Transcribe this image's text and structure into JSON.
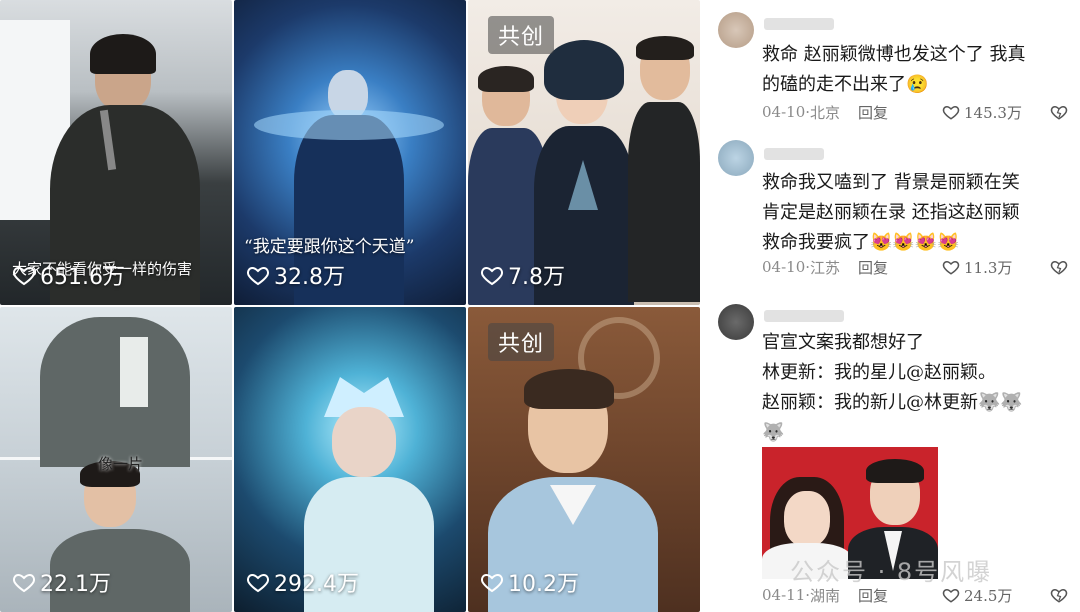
{
  "videos": [
    {
      "likes": "651.6万",
      "caption": "大家不能看你受一样的伤害",
      "badge": ""
    },
    {
      "likes": "32.8万",
      "caption": "“我定要跟你这个天道”",
      "badge": ""
    },
    {
      "likes": "7.8万",
      "caption": "",
      "badge": "共创"
    },
    {
      "likes": "22.1万",
      "caption": "像一片",
      "badge": ""
    },
    {
      "likes": "292.4万",
      "caption": "",
      "badge": ""
    },
    {
      "likes": "10.2万",
      "caption": "",
      "badge": "共创"
    }
  ],
  "comments": [
    {
      "text": "救命 赵丽颖微博也发这个了 我真\n的磕的走不出来了😢",
      "date": "04-10",
      "location": "北京",
      "reply": "回复",
      "likes": "145.3万"
    },
    {
      "text": "救命我又嗑到了 背景是丽颖在笑\n肯定是赵丽颖在录 还指这赵丽颖\n救命我要疯了😻😻😻😻",
      "date": "04-10",
      "location": "江苏",
      "reply": "回复",
      "likes": "11.3万"
    },
    {
      "text": "官宣文案我都想好了\n林更新：我的星儿@赵丽颖。\n赵丽颖：我的新儿@林更新🐺🐺\n🐺",
      "date": "04-11",
      "location": "湖南",
      "reply": "回复",
      "likes": "24.5万"
    }
  ],
  "watermark": "公众号 · 8号风曝",
  "colors": {
    "photo_bg": "#c9232b",
    "text": "#1a1a1a",
    "meta": "#8a8a8a"
  }
}
